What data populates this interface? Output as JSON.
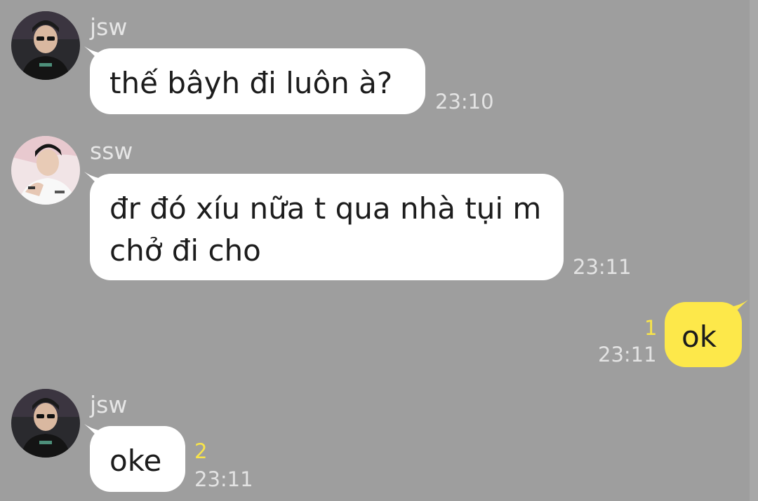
{
  "messages": [
    {
      "sender": "jsw",
      "text": "thế bâyh đi luôn à?",
      "time": "23:10",
      "avatar": "person-black-hoodie-avatar"
    },
    {
      "sender": "ssw",
      "text": "đr đó xíu nữa t qua nhà tụi m chở đi cho",
      "time": "23:11",
      "avatar": "person-white-jersey-avatar"
    },
    {
      "sender": "",
      "text": "ok",
      "time": "23:11",
      "unread": "1",
      "outgoing": true
    },
    {
      "sender": "jsw",
      "text": "oke",
      "time": "23:11",
      "unread": "2",
      "avatar": "person-black-hoodie-avatar"
    }
  ],
  "colors": {
    "background": "#9e9e9e",
    "incoming_bubble": "#ffffff",
    "outgoing_bubble": "#fde84a",
    "unread_count": "#f8e44a",
    "timestamp": "#e3e3e3",
    "sender_name": "#e6e6e6"
  }
}
